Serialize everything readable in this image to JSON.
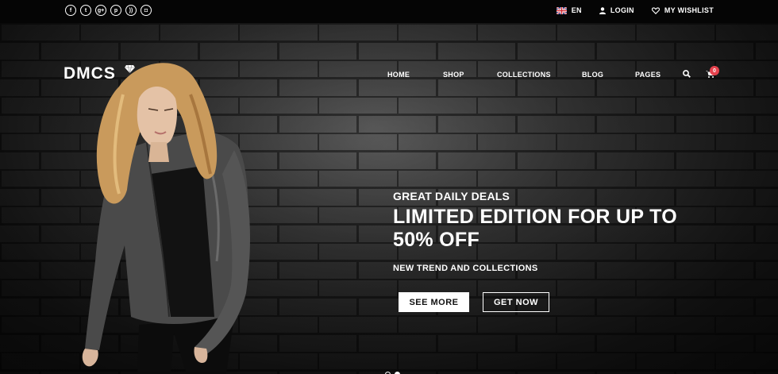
{
  "topbar": {
    "social": [
      {
        "icon": "facebook-icon",
        "glyph": "f"
      },
      {
        "icon": "twitter-icon",
        "glyph": "t"
      },
      {
        "icon": "google-plus-icon",
        "glyph": "g+"
      },
      {
        "icon": "pinterest-icon",
        "glyph": "p"
      },
      {
        "icon": "rss-icon",
        "glyph": "))"
      },
      {
        "icon": "instagram-icon",
        "glyph": "◘"
      }
    ],
    "language": "EN",
    "login": "LOGIN",
    "wishlist": "MY WISHLIST"
  },
  "header": {
    "logo": "DMCS",
    "nav": [
      "HOME",
      "SHOP",
      "COLLECTIONS",
      "BLOG",
      "PAGES"
    ],
    "cart_count": "0"
  },
  "hero": {
    "kicker": "GREAT DAILY DEALS",
    "headline": "LIMITED EDITION FOR UP TO 50% OFF",
    "subline": "NEW TREND AND COLLECTIONS",
    "btn_primary": "SEE MORE",
    "btn_secondary": "GET NOW",
    "slide_current": 2,
    "slide_total": 2
  },
  "colors": {
    "accent": "#e5424d",
    "topbar": "#050505"
  }
}
